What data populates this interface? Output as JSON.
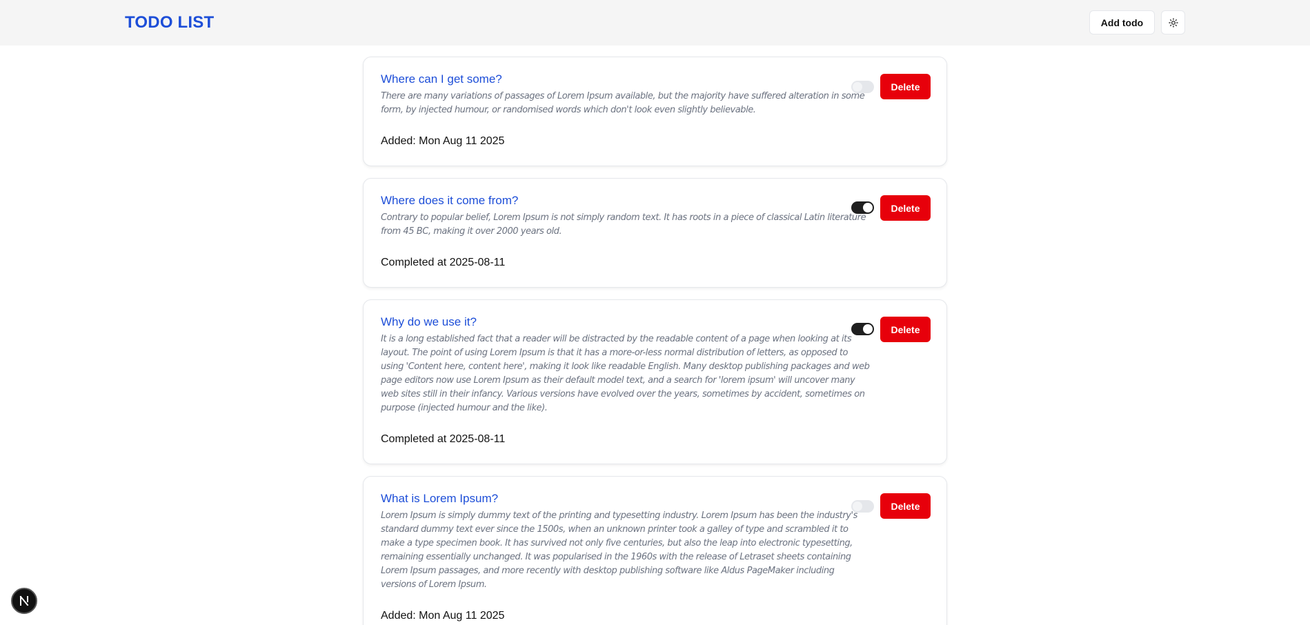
{
  "header": {
    "title": "TODO LIST",
    "add_label": "Add todo",
    "theme_icon": "sun-icon"
  },
  "todos": [
    {
      "title": "Where can I get some?",
      "description": "There are many variations of passages of Lorem Ipsum available, but the majority have suffered alteration in some form, by injected humour, or randomised words which don't look even slightly believable.",
      "footer": "Added: Mon Aug 11 2025",
      "completed": false,
      "delete_label": "Delete"
    },
    {
      "title": "Where does it come from?",
      "description": "Contrary to popular belief, Lorem Ipsum is not simply random text. It has roots in a piece of classical Latin literature from 45 BC, making it over 2000 years old.",
      "footer": "Completed at 2025-08-11",
      "completed": true,
      "delete_label": "Delete"
    },
    {
      "title": "Why do we use it?",
      "description": "It is a long established fact that a reader will be distracted by the readable content of a page when looking at its layout. The point of using Lorem Ipsum is that it has a more-or-less normal distribution of letters, as opposed to using 'Content here, content here', making it look like readable English. Many desktop publishing packages and web page editors now use Lorem Ipsum as their default model text, and a search for 'lorem ipsum' will uncover many web sites still in their infancy. Various versions have evolved over the years, sometimes by accident, sometimes on purpose (injected humour and the like).",
      "footer": "Completed at 2025-08-11",
      "completed": true,
      "delete_label": "Delete"
    },
    {
      "title": "What is Lorem Ipsum?",
      "description": "Lorem Ipsum is simply dummy text of the printing and typesetting industry. Lorem Ipsum has been the industry's standard dummy text ever since the 1500s, when an unknown printer took a galley of type and scrambled it to make a type specimen book. It has survived not only five centuries, but also the leap into electronic typesetting, remaining essentially unchanged. It was popularised in the 1960s with the release of Letraset sheets containing Lorem Ipsum passages, and more recently with desktop publishing software like Aldus PageMaker including versions of Lorem Ipsum.",
      "footer": "Added: Mon Aug 11 2025",
      "completed": false,
      "delete_label": "Delete"
    }
  ],
  "colors": {
    "title_blue": "#1d4ed8",
    "delete_red": "#e7000b",
    "toggle_on": "#1f1f1f",
    "toggle_off": "#e5e7eb"
  },
  "dev_badge": {
    "icon": "nextjs-logo-icon",
    "letter": "N"
  }
}
